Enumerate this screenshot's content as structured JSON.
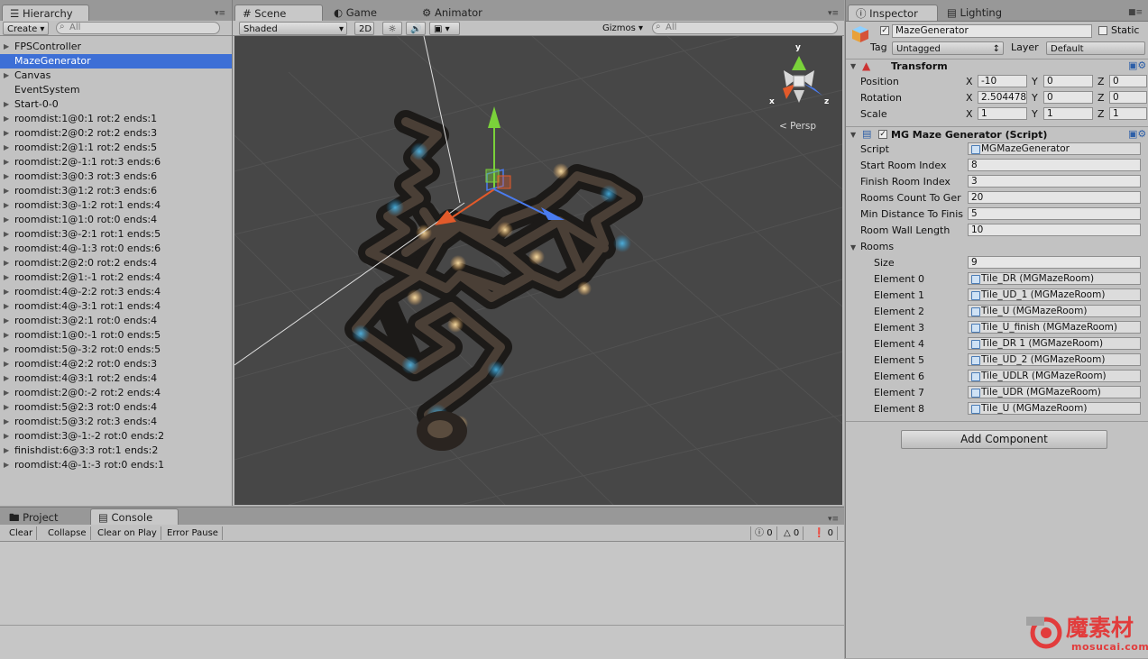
{
  "hierarchy": {
    "tab": "Hierarchy",
    "create": "Create",
    "search_placeholder": "All",
    "items": [
      {
        "label": "FPSController",
        "arrow": true,
        "selected": false
      },
      {
        "label": "MazeGenerator",
        "arrow": false,
        "selected": true
      },
      {
        "label": "Canvas",
        "arrow": true,
        "selected": false
      },
      {
        "label": "EventSystem",
        "arrow": false,
        "selected": false
      },
      {
        "label": "Start-0-0",
        "arrow": true,
        "selected": false
      },
      {
        "label": "roomdist:1@0:1 rot:2 ends:1",
        "arrow": true,
        "selected": false
      },
      {
        "label": "roomdist:2@0:2 rot:2 ends:3",
        "arrow": true,
        "selected": false
      },
      {
        "label": "roomdist:2@1:1 rot:2 ends:5",
        "arrow": true,
        "selected": false
      },
      {
        "label": "roomdist:2@-1:1 rot:3 ends:6",
        "arrow": true,
        "selected": false
      },
      {
        "label": "roomdist:3@0:3 rot:3 ends:6",
        "arrow": true,
        "selected": false
      },
      {
        "label": "roomdist:3@1:2 rot:3 ends:6",
        "arrow": true,
        "selected": false
      },
      {
        "label": "roomdist:3@-1:2 rot:1 ends:4",
        "arrow": true,
        "selected": false
      },
      {
        "label": "roomdist:1@1:0 rot:0 ends:4",
        "arrow": true,
        "selected": false
      },
      {
        "label": "roomdist:3@-2:1 rot:1 ends:5",
        "arrow": true,
        "selected": false
      },
      {
        "label": "roomdist:4@-1:3 rot:0 ends:6",
        "arrow": true,
        "selected": false
      },
      {
        "label": "roomdist:2@2:0 rot:2 ends:4",
        "arrow": true,
        "selected": false
      },
      {
        "label": "roomdist:2@1:-1 rot:2 ends:4",
        "arrow": true,
        "selected": false
      },
      {
        "label": "roomdist:4@-2:2 rot:3 ends:4",
        "arrow": true,
        "selected": false
      },
      {
        "label": "roomdist:4@-3:1 rot:1 ends:4",
        "arrow": true,
        "selected": false
      },
      {
        "label": "roomdist:3@2:1 rot:0 ends:4",
        "arrow": true,
        "selected": false
      },
      {
        "label": "roomdist:1@0:-1 rot:0 ends:5",
        "arrow": true,
        "selected": false
      },
      {
        "label": "roomdist:5@-3:2 rot:0 ends:5",
        "arrow": true,
        "selected": false
      },
      {
        "label": "roomdist:4@2:2 rot:0 ends:3",
        "arrow": true,
        "selected": false
      },
      {
        "label": "roomdist:4@3:1 rot:2 ends:4",
        "arrow": true,
        "selected": false
      },
      {
        "label": "roomdist:2@0:-2 rot:2 ends:4",
        "arrow": true,
        "selected": false
      },
      {
        "label": "roomdist:5@2:3 rot:0 ends:4",
        "arrow": true,
        "selected": false
      },
      {
        "label": "roomdist:5@3:2 rot:3 ends:4",
        "arrow": true,
        "selected": false
      },
      {
        "label": "roomdist:3@-1:-2 rot:0 ends:2",
        "arrow": true,
        "selected": false
      },
      {
        "label": "finishdist:6@3:3 rot:1 ends:2",
        "arrow": true,
        "selected": false
      },
      {
        "label": "roomdist:4@-1:-3 rot:0 ends:1",
        "arrow": true,
        "selected": false
      }
    ]
  },
  "scene": {
    "tabs": {
      "scene": "Scene",
      "game": "Game",
      "animator": "Animator"
    },
    "shading": "Shaded",
    "mode_2d": "2D",
    "gizmos": "Gizmos",
    "search_placeholder": "All",
    "persp": "< Persp",
    "gizmo_axes": {
      "y": "y",
      "x": "x",
      "z": "z"
    }
  },
  "console": {
    "tabs": {
      "project": "Project",
      "console": "Console"
    },
    "buttons": {
      "clear": "Clear",
      "collapse": "Collapse",
      "clear_on_play": "Clear on Play",
      "error_pause": "Error Pause"
    },
    "counts": {
      "info": "0",
      "warn": "0",
      "error": "0"
    }
  },
  "inspector": {
    "tabs": {
      "inspector": "Inspector",
      "lighting": "Lighting"
    },
    "object_name": "MazeGenerator",
    "static_label": "Static",
    "tag_label": "Tag",
    "tag_value": "Untagged",
    "layer_label": "Layer",
    "layer_value": "Default",
    "transform": {
      "title": "Transform",
      "position": {
        "label": "Position",
        "x": "-10",
        "y": "0",
        "z": "0"
      },
      "rotation": {
        "label": "Rotation",
        "x": "2.504478",
        "y": "0",
        "z": "0"
      },
      "scale": {
        "label": "Scale",
        "x": "1",
        "y": "1",
        "z": "1"
      },
      "axis_x": "X",
      "axis_y": "Y",
      "axis_z": "Z"
    },
    "script_comp": {
      "title": "MG Maze Generator (Script)",
      "fields": [
        {
          "label": "Script",
          "value": "MGMazeGenerator",
          "obj": true
        },
        {
          "label": "Start Room Index",
          "value": "8",
          "obj": false
        },
        {
          "label": "Finish Room Index",
          "value": "3",
          "obj": false
        },
        {
          "label": "Rooms Count To Ger",
          "value": "20",
          "obj": false
        },
        {
          "label": "Min Distance To Finis",
          "value": "5",
          "obj": false
        },
        {
          "label": "Room Wall Length",
          "value": "10",
          "obj": false
        }
      ],
      "rooms_label": "Rooms",
      "size_label": "Size",
      "size_value": "9",
      "elements": [
        {
          "label": "Element 0",
          "value": "Tile_DR (MGMazeRoom)"
        },
        {
          "label": "Element 1",
          "value": "Tile_UD_1 (MGMazeRoom)"
        },
        {
          "label": "Element 2",
          "value": "Tile_U (MGMazeRoom)"
        },
        {
          "label": "Element 3",
          "value": "Tile_U_finish (MGMazeRoom)"
        },
        {
          "label": "Element 4",
          "value": "Tile_DR 1 (MGMazeRoom)"
        },
        {
          "label": "Element 5",
          "value": "Tile_UD_2 (MGMazeRoom)"
        },
        {
          "label": "Element 6",
          "value": "Tile_UDLR (MGMazeRoom)"
        },
        {
          "label": "Element 7",
          "value": "Tile_UDR (MGMazeRoom)"
        },
        {
          "label": "Element 8",
          "value": "Tile_U (MGMazeRoom)"
        }
      ]
    },
    "add_component": "Add Component"
  },
  "watermark": {
    "brand": "魔素材",
    "url": "mosucai.com"
  },
  "colors": {
    "selection": "#3d6fd6",
    "viewport": "#474747",
    "accent_glow": "#3fb4e8",
    "lamp": "#ffd28a"
  }
}
